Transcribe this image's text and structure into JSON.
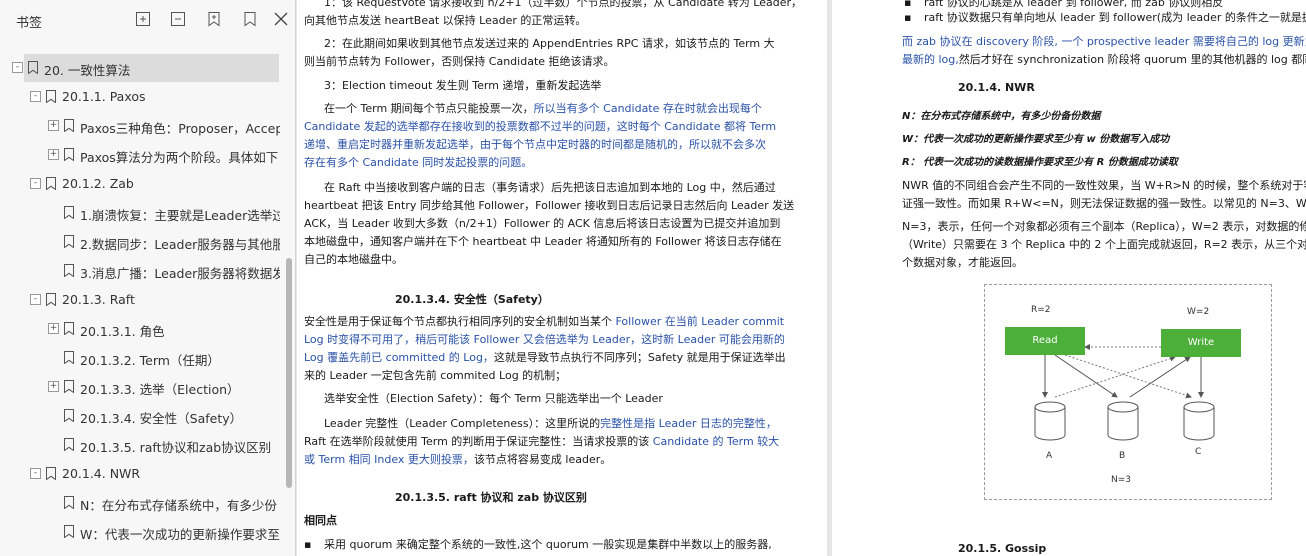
{
  "sidebar": {
    "title": "书签",
    "toolbar": [
      "expand-all-icon",
      "collapse-all-icon",
      "add-bookmark-icon",
      "bookmark-icon",
      "close-icon"
    ],
    "items": [
      {
        "label": "20. 一致性算法",
        "level": 0,
        "expander": "-",
        "selected": true
      },
      {
        "label": "20.1.1. Paxos",
        "level": 1,
        "expander": "-"
      },
      {
        "label": "Paxos三种角色：Proposer，Accep",
        "level": 2,
        "expander": "+"
      },
      {
        "label": "Paxos算法分为两个阶段。具体如下",
        "level": 2,
        "expander": "+"
      },
      {
        "label": "20.1.2. Zab",
        "level": 1,
        "expander": "-"
      },
      {
        "label": "1.崩溃恢复：主要就是Leader选举过",
        "level": 2,
        "expander": ""
      },
      {
        "label": "2.数据同步：Leader服务器与其他服",
        "level": 2,
        "expander": ""
      },
      {
        "label": "3.消息广播：Leader服务器将数据发",
        "level": 2,
        "expander": ""
      },
      {
        "label": "20.1.3. Raft",
        "level": 1,
        "expander": "-"
      },
      {
        "label": "20.1.3.1. 角色",
        "level": 2,
        "expander": "+"
      },
      {
        "label": "20.1.3.2. Term（任期）",
        "level": 2,
        "expander": ""
      },
      {
        "label": "20.1.3.3. 选举（Election）",
        "level": 2,
        "expander": "+"
      },
      {
        "label": "20.1.3.4.  安全性（Safety）",
        "level": 2,
        "expander": ""
      },
      {
        "label": "20.1.3.5. raft协议和zab协议区别",
        "level": 2,
        "expander": ""
      },
      {
        "label": "20.1.4. NWR",
        "level": 1,
        "expander": "-"
      },
      {
        "label": "N：在分布式存储系统中，有多少份",
        "level": 2,
        "expander": ""
      },
      {
        "label": "W：代表一次成功的更新操作要求至",
        "level": 2,
        "expander": ""
      }
    ]
  },
  "page1": {
    "lines": [
      {
        "t": "1：该 RequestVote 请求接收到 n/2+1（过半数）个节点的投票，从 Candidate 转为 Leader，",
        "c": ""
      },
      {
        "t": "向其他节点发送 heartBeat 以保持 Leader 的正常运转。",
        "c": ""
      },
      {
        "t": "2：在此期间如果收到其他节点发送过来的 AppendEntries RPC 请求，如该节点的 Term 大",
        "c": ""
      },
      {
        "t": "则当前节点转为 Follower，否则保持 Candidate 拒绝该请求。",
        "c": ""
      },
      {
        "t": "3：Election timeout 发生则 Term 递增，重新发起选举",
        "c": ""
      },
      {
        "t": "在一个 Term 期间每个节点只能投票一次，",
        "c": "",
        "t2": "所以当有多个 Candidate 存在时就会出现每个"
      },
      {
        "t": "Candidate 发起的选举都存在接收到的投票数都不过半的问题，这时每个 Candidate 都将 Term",
        "c": "blue"
      },
      {
        "t": "递增、重启定时器并重新发起选举，由于每个节点中定时器的时间都是随机的，所以就不会多次",
        "c": "blue"
      },
      {
        "t": "存在有多个 Candidate 同时发起投票的问题。",
        "c": "blue"
      },
      {
        "t": "在 Raft 中当接收到客户端的日志（事务请求）后先把该日志追加到本地的 Log 中，然后通过",
        "c": ""
      },
      {
        "t": "heartbeat 把该 Entry 同步给其他 Follower，Follower 接收到日志后记录日志然后向 Leader 发送",
        "c": ""
      },
      {
        "t": "ACK，当 Leader 收到大多数（n/2+1）Follower 的 ACK 信息后将该日志设置为已提交并追加到",
        "c": ""
      },
      {
        "t": "本地磁盘中，通知客户端并在下个 heartbeat 中 Leader 将通知所有的 Follower 将该日志存储在",
        "c": ""
      },
      {
        "t": "自己的本地磁盘中。",
        "c": ""
      }
    ],
    "heading_safety": "20.1.3.4.    安全性（Safety）",
    "safety_lines": [
      {
        "t": "安全性是用于保证每个节点都执行相同序列的安全机制如当某个 ",
        "t2": "Follower 在当前 Leader commit"
      },
      {
        "t": "",
        "t2": "Log 时变得不可用了，稍后可能该 Follower 又会倍选举为 Leader，这时新 Leader 可能会用新的"
      },
      {
        "t": "",
        "t2": "Log 覆盖先前已 committed 的 Log，",
        "t3": "这就是导致节点执行不同序列；Safety 就是用于保证选举出"
      },
      {
        "t": "来的 Leader 一定包含先前 commited Log 的机制；",
        "t2": ""
      },
      {
        "t": "选举安全性（Election Safety）：每个 Term 只能选举出一个 Leader",
        "t2": ""
      },
      {
        "t": "Leader 完整性（Leader Completeness）：这里所说的",
        "t2": "完整性是指 Leader 日志的完整性，"
      },
      {
        "t": "Raft 在选举阶段就使用 Term 的判断用于保证完整性：当请求投票的该 ",
        "t2": "Candidate 的 Term 较大"
      },
      {
        "t": "",
        "t2": "或 Term 相同 Index 更大则投票，",
        "t3": "该节点将容易变成 leader。"
      }
    ],
    "heading_raftzab": "20.1.3.5.    raft 协议和 zab 协议区别",
    "same_points": "相同点",
    "bullet1": "采用 quorum 来确定整个系统的一致性,这个 quorum 一般实现是集群中半数以上的服务器,"
  },
  "page2": {
    "bullets_top": [
      "raft 协议的心跳是从 leader 到 follower, 而 zab 协议则相反",
      "raft 协议数据只有单向地从 leader 到 follower(成为 leader 的条件之一就是拥有最"
    ],
    "zab_line1": "而 zab 协议在 discovery 阶段, 一个 prospective leader 需要将自己的 log 更新为 quo",
    "zab_line2a": "最新的 log,",
    "zab_line2b": "然后才好在 synchronization 阶段将 quorum 里的其他机器的 log 都同步到",
    "heading_nwr": "20.1.4.    NWR",
    "def_n": "N：在分布式存储系统中，有多少份备份数据",
    "def_w": "W：代表一次成功的更新操作要求至少有 w 份数据写入成功",
    "def_r": "R：  代表一次成功的读数据操作要求至少有 R 份数据成功读取",
    "para": [
      "NWR 值的不同组合会产生不同的一致性效果，当 W+R>N 的时候，整个系统对于客户端",
      "证强一致性。而如果 R+W<=N，则无法保证数据的强一致性。以常见的 N=3、W=2、",
      "N=3，表示，任何一个对象都必须有三个副本（Replica），W=2 表示，对数据的修",
      "（Write）只需要在 3 个 Replica 中的 2 个上面完成就返回，R=2 表示，从三个对象中要",
      "个数据对象，才能返回。"
    ],
    "figure": {
      "r_label": "R=2",
      "w_label": "W=2",
      "read_label": "Read",
      "write_label": "Write",
      "a": "A",
      "b": "B",
      "c": "C",
      "n_label": "N=3"
    },
    "heading_gossip": "20.1.5.    Gossip"
  },
  "colors": {
    "accent_blue": "#2a52a8",
    "node_green": "#4caf3a",
    "selected": "#dcdcdc"
  }
}
